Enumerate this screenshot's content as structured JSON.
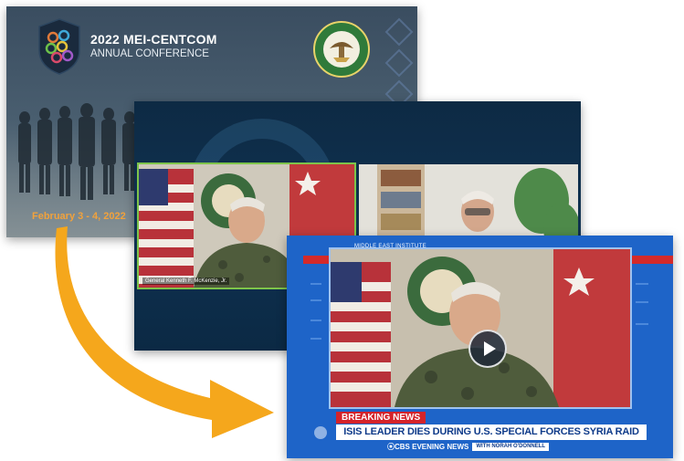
{
  "conference": {
    "title": "2022 MEI-CENTCOM",
    "subtitle": "ANNUAL CONFERENCE",
    "dates": "February 3 - 4, 2022",
    "accent_color": "#f1a23c"
  },
  "video_call": {
    "left_tile_caption": "General Kenneth F. McKenzie, Jr.",
    "active_border_color": "#7ec44a"
  },
  "broadcast": {
    "channel_tag": "MIDDLE EAST INSTITUTE",
    "breaking_label": "BREAKING NEWS",
    "headline": "ISIS LEADER DIES DURING U.S. SPECIAL FORCES SYRIA RAID",
    "program": "⦿CBS EVENING NEWS",
    "anchor": "WITH NORAH O'DONNELL",
    "play_icon": "play-icon",
    "brand_color": "#1e64c8",
    "breaking_color": "#d4232a"
  },
  "arrow": {
    "color": "#f5a71c"
  }
}
